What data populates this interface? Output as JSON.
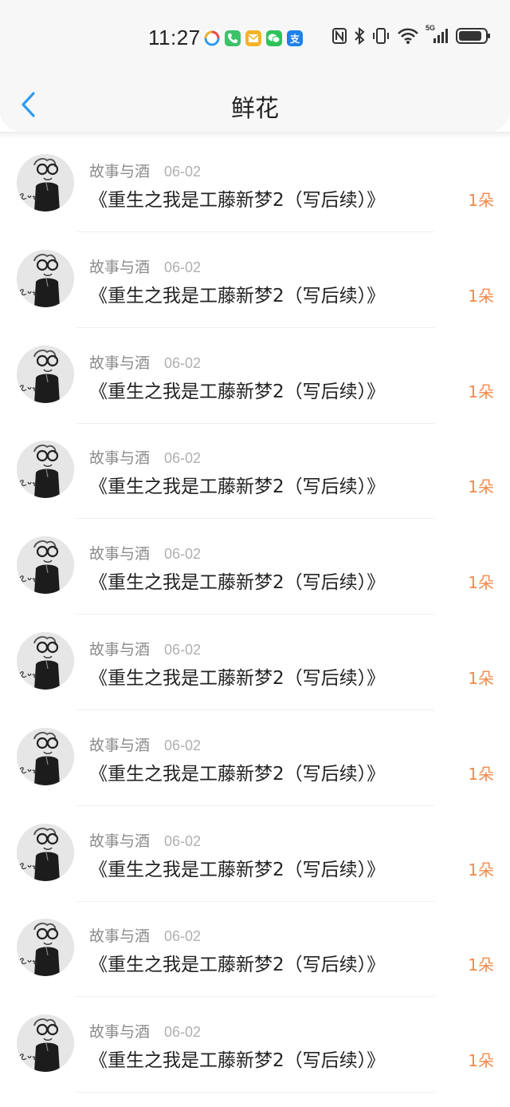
{
  "status_bar": {
    "time": "11:27",
    "network_label": "5G",
    "app_icons": [
      {
        "name": "browser-app-icon",
        "color": "#ffffff"
      },
      {
        "name": "phone-app-icon",
        "color": "#3cc26a"
      },
      {
        "name": "mail-app-icon",
        "color": "#f4b22c"
      },
      {
        "name": "wechat-app-icon",
        "color": "#2dc35b"
      },
      {
        "name": "alipay-app-icon",
        "color": "#1e80e8"
      }
    ]
  },
  "nav": {
    "back_icon": "chevron-left-icon",
    "title": "鲜花",
    "accent_color": "#2f9bf0"
  },
  "list": {
    "count_color": "#f08a4b",
    "items": [
      {
        "author": "故事与酒",
        "date": "06-02",
        "title": "《重生之我是工藤新梦2（写后续）》",
        "count": "1朵"
      },
      {
        "author": "故事与酒",
        "date": "06-02",
        "title": "《重生之我是工藤新梦2（写后续）》",
        "count": "1朵"
      },
      {
        "author": "故事与酒",
        "date": "06-02",
        "title": "《重生之我是工藤新梦2（写后续）》",
        "count": "1朵"
      },
      {
        "author": "故事与酒",
        "date": "06-02",
        "title": "《重生之我是工藤新梦2（写后续）》",
        "count": "1朵"
      },
      {
        "author": "故事与酒",
        "date": "06-02",
        "title": "《重生之我是工藤新梦2（写后续）》",
        "count": "1朵"
      },
      {
        "author": "故事与酒",
        "date": "06-02",
        "title": "《重生之我是工藤新梦2（写后续）》",
        "count": "1朵"
      },
      {
        "author": "故事与酒",
        "date": "06-02",
        "title": "《重生之我是工藤新梦2（写后续）》",
        "count": "1朵"
      },
      {
        "author": "故事与酒",
        "date": "06-02",
        "title": "《重生之我是工藤新梦2（写后续）》",
        "count": "1朵"
      },
      {
        "author": "故事与酒",
        "date": "06-02",
        "title": "《重生之我是工藤新梦2（写后续）》",
        "count": "1朵"
      },
      {
        "author": "故事与酒",
        "date": "06-02",
        "title": "《重生之我是工藤新梦2（写后续）》",
        "count": "1朵"
      }
    ]
  }
}
